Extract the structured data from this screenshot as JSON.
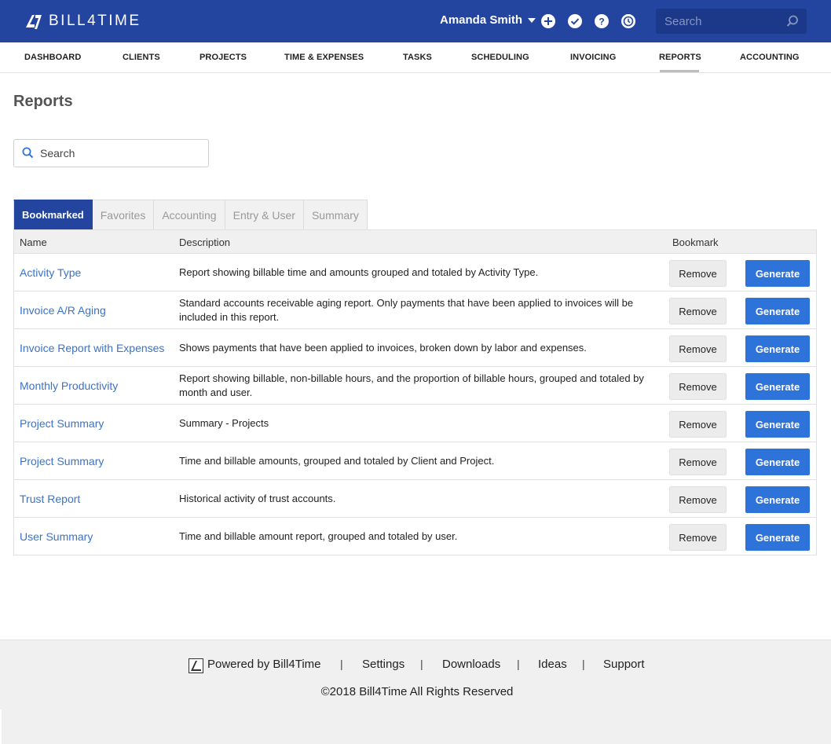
{
  "header": {
    "brand": "BILL4TIME",
    "user_name": "Amanda Smith",
    "search_placeholder": "Search",
    "icons": [
      "plus-circle-icon",
      "check-circle-icon",
      "help-circle-icon",
      "clock-icon",
      "search-icon"
    ],
    "colors": {
      "header_bg": "#23449f",
      "search_bg": "#1c3888"
    }
  },
  "nav": {
    "items": [
      "DASHBOARD",
      "CLIENTS",
      "PROJECTS",
      "TIME & EXPENSES",
      "TASKS",
      "SCHEDULING",
      "INVOICING",
      "REPORTS",
      "ACCOUNTING"
    ],
    "active": "REPORTS"
  },
  "page": {
    "title": "Reports",
    "search_placeholder": "Search"
  },
  "tabs": {
    "items": [
      "Bookmarked",
      "Favorites",
      "Accounting",
      "Entry & User",
      "Summary"
    ],
    "active": "Bookmarked"
  },
  "table": {
    "headers": {
      "name": "Name",
      "description": "Description",
      "bookmark": "Bookmark"
    },
    "remove_label": "Remove",
    "generate_label": "Generate",
    "rows": [
      {
        "name": "Activity Type",
        "description": "Report showing billable time and amounts grouped and totaled by Activity Type."
      },
      {
        "name": "Invoice A/R Aging",
        "description": "Standard accounts receivable aging report. Only payments that have been applied to invoices will be included in this report."
      },
      {
        "name": "Invoice Report with Expenses",
        "description": "Shows payments that have been applied to invoices, broken down by labor and expenses."
      },
      {
        "name": "Monthly Productivity",
        "description": "Report showing billable, non-billable hours, and the proportion of billable hours, grouped and totaled by month and user."
      },
      {
        "name": "Project Summary",
        "description": "Summary - Projects"
      },
      {
        "name": "Project Summary",
        "description": "Time and billable amounts, grouped and totaled by Client and Project."
      },
      {
        "name": "Trust Report",
        "description": "Historical activity of trust accounts."
      },
      {
        "name": "User Summary",
        "description": "Time and billable amount report, grouped and totaled by user."
      }
    ],
    "colors": {
      "link": "#3a73c9",
      "generate_bg": "#2e73d9",
      "remove_bg": "#ececec"
    }
  },
  "footer": {
    "powered_by": "Powered by Bill4Time",
    "links": [
      "Settings",
      "Downloads",
      "Ideas",
      "Support"
    ],
    "separator": "|",
    "copyright": "©2018 Bill4Time All Rights Reserved"
  }
}
